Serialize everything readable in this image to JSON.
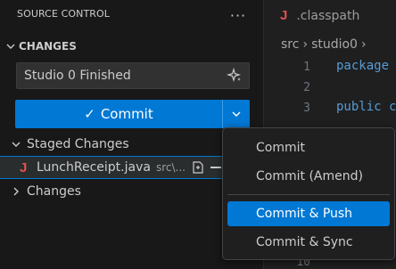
{
  "sidebar": {
    "title": "SOURCE CONTROL",
    "more_icon": "ellipsis-icon",
    "section_title": "CHANGES",
    "commit_message": "Studio 0 Finished",
    "commit_label": "Commit",
    "staged_label": "Staged Changes",
    "changes_label": "Changes",
    "staged_files": [
      {
        "name": "LunchReceipt.java",
        "path": "src\\..."
      }
    ]
  },
  "editor": {
    "tab_label": ".classpath",
    "breadcrumb": [
      "src",
      "studio0"
    ],
    "line_numbers": [
      "1",
      "2",
      "3",
      "10"
    ],
    "code_lines": [
      "package",
      "",
      "public c"
    ]
  },
  "menu": {
    "items": [
      "Commit",
      "Commit (Amend)",
      "Commit & Push",
      "Commit & Sync"
    ],
    "selected": "Commit & Push"
  },
  "colors": {
    "accent": "#0078d4",
    "java_icon": "#e05252",
    "keyword": "#569cd6"
  }
}
